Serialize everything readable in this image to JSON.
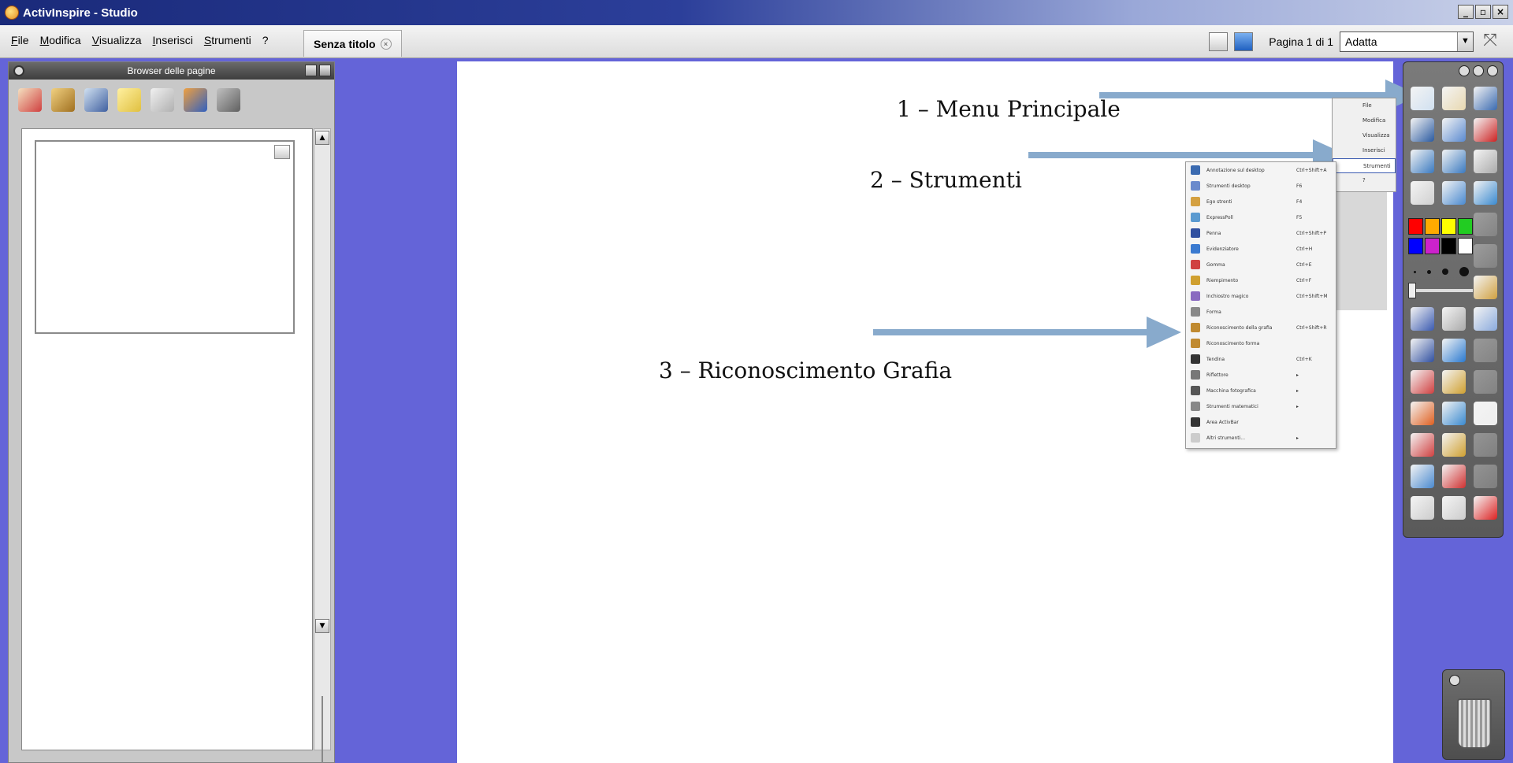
{
  "window": {
    "title": "ActivInspire - Studio",
    "controls": [
      "_",
      "▫",
      "×"
    ]
  },
  "menubar": {
    "items": [
      "File",
      "Modifica",
      "Visualizza",
      "Inserisci",
      "Strumenti",
      "?"
    ],
    "document_tab": "Senza titolo",
    "page_label": "Pagina 1 di 1",
    "zoom_value": "Adatta"
  },
  "browser": {
    "title": "Browser delle pagine"
  },
  "annotations": {
    "a1": "1 – Menu Principale",
    "a2": "2 – Strumenti",
    "a3": "3 – Riconoscimento Grafia"
  },
  "mini_menu": {
    "items": [
      "File",
      "Modifica",
      "Visualizza",
      "Inserisci",
      "Strumenti",
      "?"
    ],
    "selected": "Strumenti"
  },
  "strumenti_menu": [
    {
      "label": "Annotazione sul desktop",
      "shortcut": "Ctrl+Shift+A",
      "color": "#3a6ab0"
    },
    {
      "label": "Strumenti desktop",
      "shortcut": "F6",
      "color": "#6a8acc"
    },
    {
      "label": "Ego strenti",
      "shortcut": "F4",
      "color": "#d4a040"
    },
    {
      "label": "ExpressPoll",
      "shortcut": "F5",
      "color": "#5a9ad0"
    },
    {
      "label": "Penna",
      "shortcut": "Ctrl+Shift+P",
      "color": "#3050a0"
    },
    {
      "label": "Evidenziatore",
      "shortcut": "Ctrl+H",
      "color": "#3a7ad0"
    },
    {
      "label": "Gomma",
      "shortcut": "Ctrl+E",
      "color": "#d04040"
    },
    {
      "label": "Riempimento",
      "shortcut": "Ctrl+F",
      "color": "#d0a030"
    },
    {
      "label": "Inchiostro magico",
      "shortcut": "Ctrl+Shift+M",
      "color": "#8a6ac0"
    },
    {
      "label": "Forma",
      "shortcut": "",
      "color": "#888888"
    },
    {
      "label": "Riconoscimento della grafia",
      "shortcut": "Ctrl+Shift+R",
      "color": "#c08a30"
    },
    {
      "label": "Riconoscimento forma",
      "shortcut": "",
      "color": "#c08a30"
    },
    {
      "label": "Tendina",
      "shortcut": "Ctrl+K",
      "color": "#333333"
    },
    {
      "label": "Riflettore",
      "shortcut": "▸",
      "color": "#777777"
    },
    {
      "label": "Macchina fotografica",
      "shortcut": "▸",
      "color": "#555555"
    },
    {
      "label": "Strumenti matematici",
      "shortcut": "▸",
      "color": "#888888"
    },
    {
      "label": "Area ActivBar",
      "shortcut": "",
      "color": "#333333"
    },
    {
      "label": "Altri strumenti...",
      "shortcut": "▸",
      "color": "#cccccc"
    }
  ],
  "toolbox": {
    "palette": [
      "#ff0000",
      "#ffaa00",
      "#ffff00",
      "#22cc22",
      "#0000ff",
      "#cc22cc",
      "#000000",
      "#ffffff"
    ],
    "tools": [
      {
        "name": "main-menu-icon",
        "color": "#d0e0f0",
        "dim": false
      },
      {
        "name": "profile-icon",
        "color": "#e8d8b0",
        "dim": false
      },
      {
        "name": "pen-check-icon",
        "color": "#3a6ab0",
        "dim": false
      },
      {
        "name": "desktop-annotate-icon",
        "color": "#2a5aa0",
        "dim": false
      },
      {
        "name": "desktop-tools-icon",
        "color": "#5a8ad0",
        "dim": false
      },
      {
        "name": "dice-icon",
        "color": "#cc2222",
        "dim": false
      },
      {
        "name": "prev-page-icon",
        "color": "#3a7ac0",
        "dim": false
      },
      {
        "name": "next-page-icon",
        "color": "#3a7ac0",
        "dim": false
      },
      {
        "name": "page-flip-icon",
        "color": "#aaaaaa",
        "dim": false
      },
      {
        "name": "play-icon",
        "color": "#d0d0d0",
        "dim": false
      },
      {
        "name": "resource-icon",
        "color": "#4a8ad0",
        "dim": false
      },
      {
        "name": "camera-icon",
        "color": "#3a8ad0",
        "dim": false
      },
      {
        "name": "palette-spacer-1",
        "color": "#666666",
        "dim": true
      },
      {
        "name": "palette-spacer-2",
        "color": "#666666",
        "dim": true
      },
      {
        "name": "connector-icon",
        "color": "#aaaaaa",
        "dim": true
      },
      {
        "name": "palette-spacer-3",
        "color": "#666666",
        "dim": true
      },
      {
        "name": "palette-spacer-4",
        "color": "#666666",
        "dim": true
      },
      {
        "name": "shape-icon",
        "color": "#aaaaaa",
        "dim": true
      },
      {
        "name": "width-spacer-1",
        "color": "#666666",
        "dim": true
      },
      {
        "name": "width-spacer-2",
        "color": "#666666",
        "dim": true
      },
      {
        "name": "marker-icon",
        "color": "#d0a040",
        "dim": false
      },
      {
        "name": "select-icon",
        "color": "#3a5ab0",
        "dim": false
      },
      {
        "name": "tools-icon",
        "color": "#aaaaaa",
        "dim": false
      },
      {
        "name": "line-icon",
        "color": "#8aaadd",
        "dim": false
      },
      {
        "name": "pen-icon",
        "color": "#3050a0",
        "dim": false
      },
      {
        "name": "highlighter-icon",
        "color": "#2a7ad0",
        "dim": false
      },
      {
        "name": "blank-icon",
        "color": "#bbbbbb",
        "dim": true
      },
      {
        "name": "eraser-icon",
        "color": "#d04040",
        "dim": false
      },
      {
        "name": "fill-icon",
        "color": "#d0a030",
        "dim": false
      },
      {
        "name": "arrow-dim-icon",
        "color": "#bbbbbb",
        "dim": true
      },
      {
        "name": "shape-fill-icon",
        "color": "#e06020",
        "dim": false
      },
      {
        "name": "connector-line-icon",
        "color": "#3a8ad0",
        "dim": false
      },
      {
        "name": "duplicate-icon",
        "color": "#eeeeee",
        "dim": false
      },
      {
        "name": "page-icon",
        "color": "#d04040",
        "dim": false
      },
      {
        "name": "media-icon",
        "color": "#d0a030",
        "dim": false
      },
      {
        "name": "unknown-dim-icon",
        "color": "#bbbbbb",
        "dim": true
      },
      {
        "name": "activote-icon",
        "color": "#4a8ad0",
        "dim": false
      },
      {
        "name": "reset-icon",
        "color": "#d03030",
        "dim": false
      },
      {
        "name": "star-dim-icon",
        "color": "#bbbbbb",
        "dim": true
      },
      {
        "name": "undo-icon",
        "color": "#cccccc",
        "dim": false
      },
      {
        "name": "redo-icon",
        "color": "#cccccc",
        "dim": false
      },
      {
        "name": "clear-icon",
        "color": "#dd2222",
        "dim": false
      }
    ]
  }
}
